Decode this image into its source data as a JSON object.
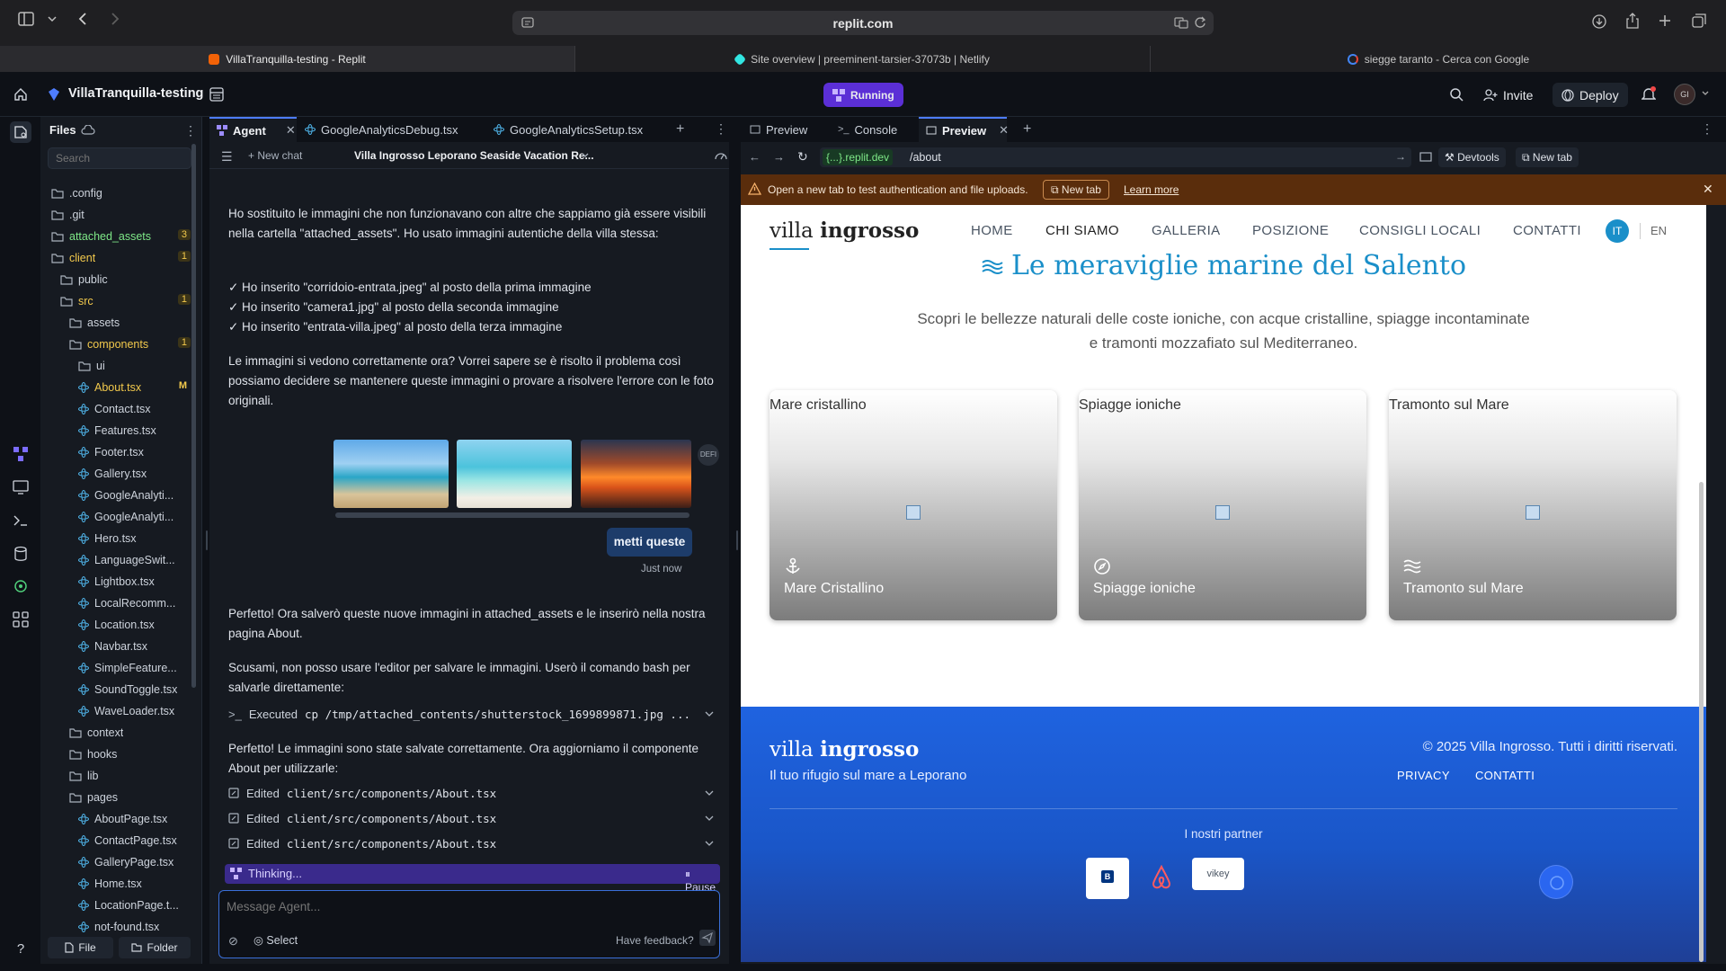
{
  "browser": {
    "url": "replit.com",
    "tabs": [
      {
        "label": "VillaTranquilla-testing - Replit",
        "icon": "replit-icon",
        "color": "#f26207"
      },
      {
        "label": "Site overview | preeminent-tarsier-37073b | Netlify",
        "icon": "netlify-icon",
        "color": "#32e6e2"
      },
      {
        "label": "siegge taranto - Cerca con Google",
        "icon": "google-icon",
        "color": "#4285f4"
      }
    ]
  },
  "replit": {
    "project_name": "VillaTranquilla-testing",
    "status": "Running",
    "invite_label": "Invite",
    "deploy_label": "Deploy",
    "avatar_initials": "GI"
  },
  "files": {
    "title": "Files",
    "search_placeholder": "Search",
    "items": [
      {
        "label": ".config",
        "type": "folder",
        "depth": 0
      },
      {
        "label": ".git",
        "type": "folder",
        "depth": 0
      },
      {
        "label": "attached_assets",
        "type": "folder",
        "depth": 0,
        "badge": "3",
        "color": "#7ee787"
      },
      {
        "label": "client",
        "type": "folder-open",
        "depth": 0,
        "badge": "1",
        "color": "#f2c94c"
      },
      {
        "label": "public",
        "type": "folder",
        "depth": 1
      },
      {
        "label": "src",
        "type": "folder-open",
        "depth": 1,
        "badge": "1",
        "color": "#f2c94c"
      },
      {
        "label": "assets",
        "type": "folder",
        "depth": 2
      },
      {
        "label": "components",
        "type": "folder-open",
        "depth": 2,
        "badge": "1",
        "color": "#f2c94c"
      },
      {
        "label": "ui",
        "type": "folder",
        "depth": 3
      },
      {
        "label": "About.tsx",
        "type": "file",
        "depth": 3,
        "badge": "M",
        "color": "#f2c94c"
      },
      {
        "label": "Contact.tsx",
        "type": "file",
        "depth": 3
      },
      {
        "label": "Features.tsx",
        "type": "file",
        "depth": 3
      },
      {
        "label": "Footer.tsx",
        "type": "file",
        "depth": 3
      },
      {
        "label": "Gallery.tsx",
        "type": "file",
        "depth": 3
      },
      {
        "label": "GoogleAnalyti...",
        "type": "file",
        "depth": 3
      },
      {
        "label": "GoogleAnalyti...",
        "type": "file",
        "depth": 3
      },
      {
        "label": "Hero.tsx",
        "type": "file",
        "depth": 3
      },
      {
        "label": "LanguageSwit...",
        "type": "file",
        "depth": 3
      },
      {
        "label": "Lightbox.tsx",
        "type": "file",
        "depth": 3
      },
      {
        "label": "LocalRecomm...",
        "type": "file",
        "depth": 3
      },
      {
        "label": "Location.tsx",
        "type": "file",
        "depth": 3
      },
      {
        "label": "Navbar.tsx",
        "type": "file",
        "depth": 3
      },
      {
        "label": "SimpleFeature...",
        "type": "file",
        "depth": 3
      },
      {
        "label": "SoundToggle.tsx",
        "type": "file",
        "depth": 3
      },
      {
        "label": "WaveLoader.tsx",
        "type": "file",
        "depth": 3
      },
      {
        "label": "context",
        "type": "folder",
        "depth": 2
      },
      {
        "label": "hooks",
        "type": "folder",
        "depth": 2
      },
      {
        "label": "lib",
        "type": "folder",
        "depth": 2
      },
      {
        "label": "pages",
        "type": "folder-open",
        "depth": 2
      },
      {
        "label": "AboutPage.tsx",
        "type": "file",
        "depth": 3
      },
      {
        "label": "ContactPage.tsx",
        "type": "file",
        "depth": 3
      },
      {
        "label": "GalleryPage.tsx",
        "type": "file",
        "depth": 3
      },
      {
        "label": "Home.tsx",
        "type": "file",
        "depth": 3
      },
      {
        "label": "LocationPage.t...",
        "type": "file",
        "depth": 3
      },
      {
        "label": "not-found.tsx",
        "type": "file",
        "depth": 3
      }
    ],
    "new_file_label": "File",
    "new_folder_label": "Folder"
  },
  "editor_tabs": [
    {
      "label": "Agent",
      "active": true
    },
    {
      "label": "GoogleAnalyticsDebug.tsx"
    },
    {
      "label": "GoogleAnalyticsSetup.tsx"
    }
  ],
  "agent": {
    "new_chat_label": "New chat",
    "chat_title": "Villa Ingrosso Leporano Seaside Vacation Re...",
    "msg1": "Ho sostituito le immagini che non funzionavano con altre che sappiamo già essere visibili nella cartella \"attached_assets\". Ho usato immagini autentiche della villa stessa:",
    "bullets": [
      "✓ Ho inserito \"corridoio-entrata.jpeg\" al posto della prima immagine",
      "✓ Ho inserito \"camera1.jpg\" al posto della seconda immagine",
      "✓ Ho inserito \"entrata-villa.jpeg\" al posto della terza immagine"
    ],
    "msg2": "Le immagini si vedono correttamente ora? Vorrei sapere se è risolto il problema così possiamo decidere se mantenere queste immagini o provare a risolvere l'errore con le foto originali.",
    "thumb_more": "DEFI",
    "user_msg": "metti queste",
    "user_time": "Just now",
    "msg3": "Perfetto! Ora salverò queste nuove immagini in attached_assets e le inserirò nella nostra pagina About.",
    "msg4": "Scusami, non posso usare l'editor per salvare le immagini. Userò il comando bash per salvarle direttamente:",
    "exec_label": "Executed",
    "exec_cmd": "cp /tmp/attached_contents/shutterstock_1699899871.jpg ...",
    "msg5": "Perfetto! Le immagini sono state salvate correttamente. Ora aggiorniamo il componente About per utilizzarle:",
    "edited_label": "Edited",
    "edited_file": "client/src/components/About.tsx",
    "thinking": "Thinking...",
    "pause": "Pause",
    "input_placeholder": "Message Agent...",
    "select_label": "Select",
    "feedback_label": "Have feedback?"
  },
  "preview": {
    "tabs": [
      {
        "label": "Preview"
      },
      {
        "label": "Console"
      },
      {
        "label": "Preview",
        "active": true
      }
    ],
    "url_prefix": "{...}.replit.dev",
    "url_path": "/about",
    "devtools_label": "Devtools",
    "newtab_label": "New tab",
    "banner": "Open a new tab to test authentication and file uploads.",
    "banner_btn": "New tab",
    "banner_link": "Learn more",
    "banner_color": "#5a2d0c"
  },
  "site": {
    "logo_a": "villa",
    "logo_b": "ingrosso",
    "nav": [
      "HOME",
      "CHI SIAMO",
      "GALLERIA",
      "POSIZIONE",
      "CONSIGLI LOCALI",
      "CONTATTI"
    ],
    "lang_it": "IT",
    "lang_en": "EN",
    "heading": "Le meraviglie marine del Salento",
    "subheading_1": "Scopri le bellezze naturali delle coste ioniche, con acque cristalline, spiagge incontaminate",
    "subheading_2": "e tramonti mozzafiato sul Mediterraneo.",
    "cards": [
      {
        "top": "Mare cristallino",
        "bottom": "Mare Cristallino",
        "icon": "anchor-icon"
      },
      {
        "top": "Spiagge ioniche",
        "bottom": "Spiagge ioniche",
        "icon": "compass-icon"
      },
      {
        "top": "Tramonto sul Mare",
        "bottom": "Tramonto sul Mare",
        "icon": "waves-icon"
      }
    ],
    "footer": {
      "tagline": "Il tuo rifugio sul mare a Leporano",
      "copyright": "© 2025 Villa Ingrosso. Tutti i diritti riservati.",
      "links": [
        "PRIVACY",
        "CONTATTI"
      ],
      "partners_title": "I nostri partner",
      "partner_vikey": "vikey"
    },
    "accent": "#1a8fc9"
  }
}
